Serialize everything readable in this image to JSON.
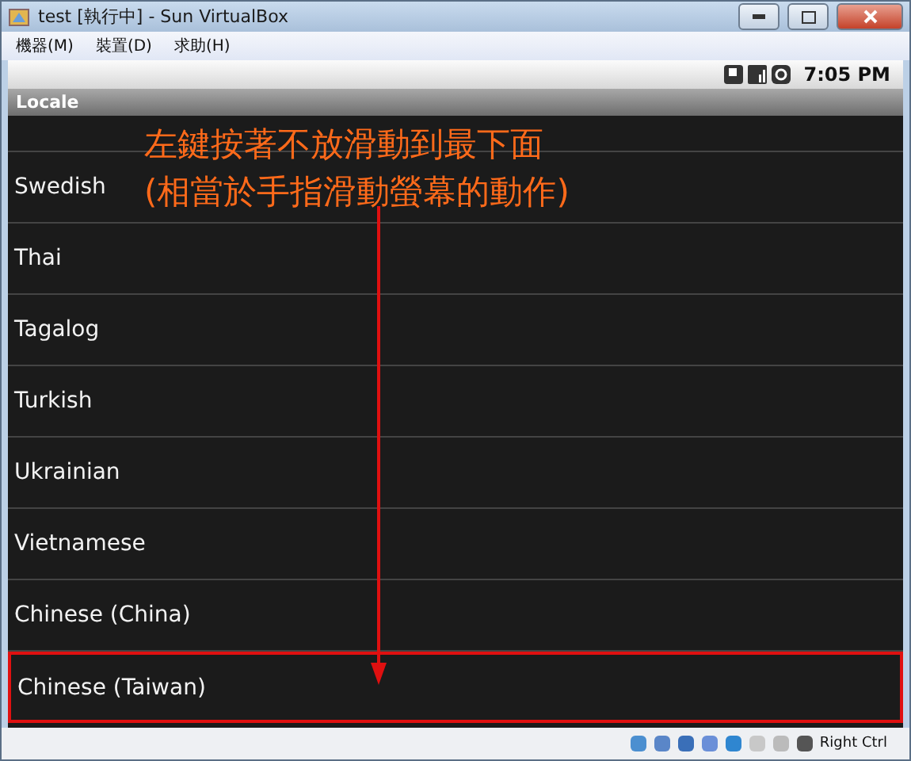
{
  "window": {
    "title": "test [執行中] - Sun VirtualBox"
  },
  "menu": [
    "機器(M)",
    "裝置(D)",
    "求助(H)"
  ],
  "android_status": {
    "time": "7:05 PM"
  },
  "header": {
    "title": "Locale"
  },
  "locales": [
    {
      "name": "Swedish",
      "selected": false
    },
    {
      "name": "Thai",
      "selected": false
    },
    {
      "name": "Tagalog",
      "selected": false
    },
    {
      "name": "Turkish",
      "selected": false
    },
    {
      "name": "Ukrainian",
      "selected": false
    },
    {
      "name": "Vietnamese",
      "selected": false
    },
    {
      "name": "Chinese (China)",
      "selected": false
    },
    {
      "name": "Chinese (Taiwan)",
      "selected": true
    }
  ],
  "annotation": [
    "左鍵按著不放滑動到最下面",
    "(相當於手指滑動螢幕的動作)"
  ],
  "status_bar": {
    "host_key": "Right Ctrl"
  }
}
